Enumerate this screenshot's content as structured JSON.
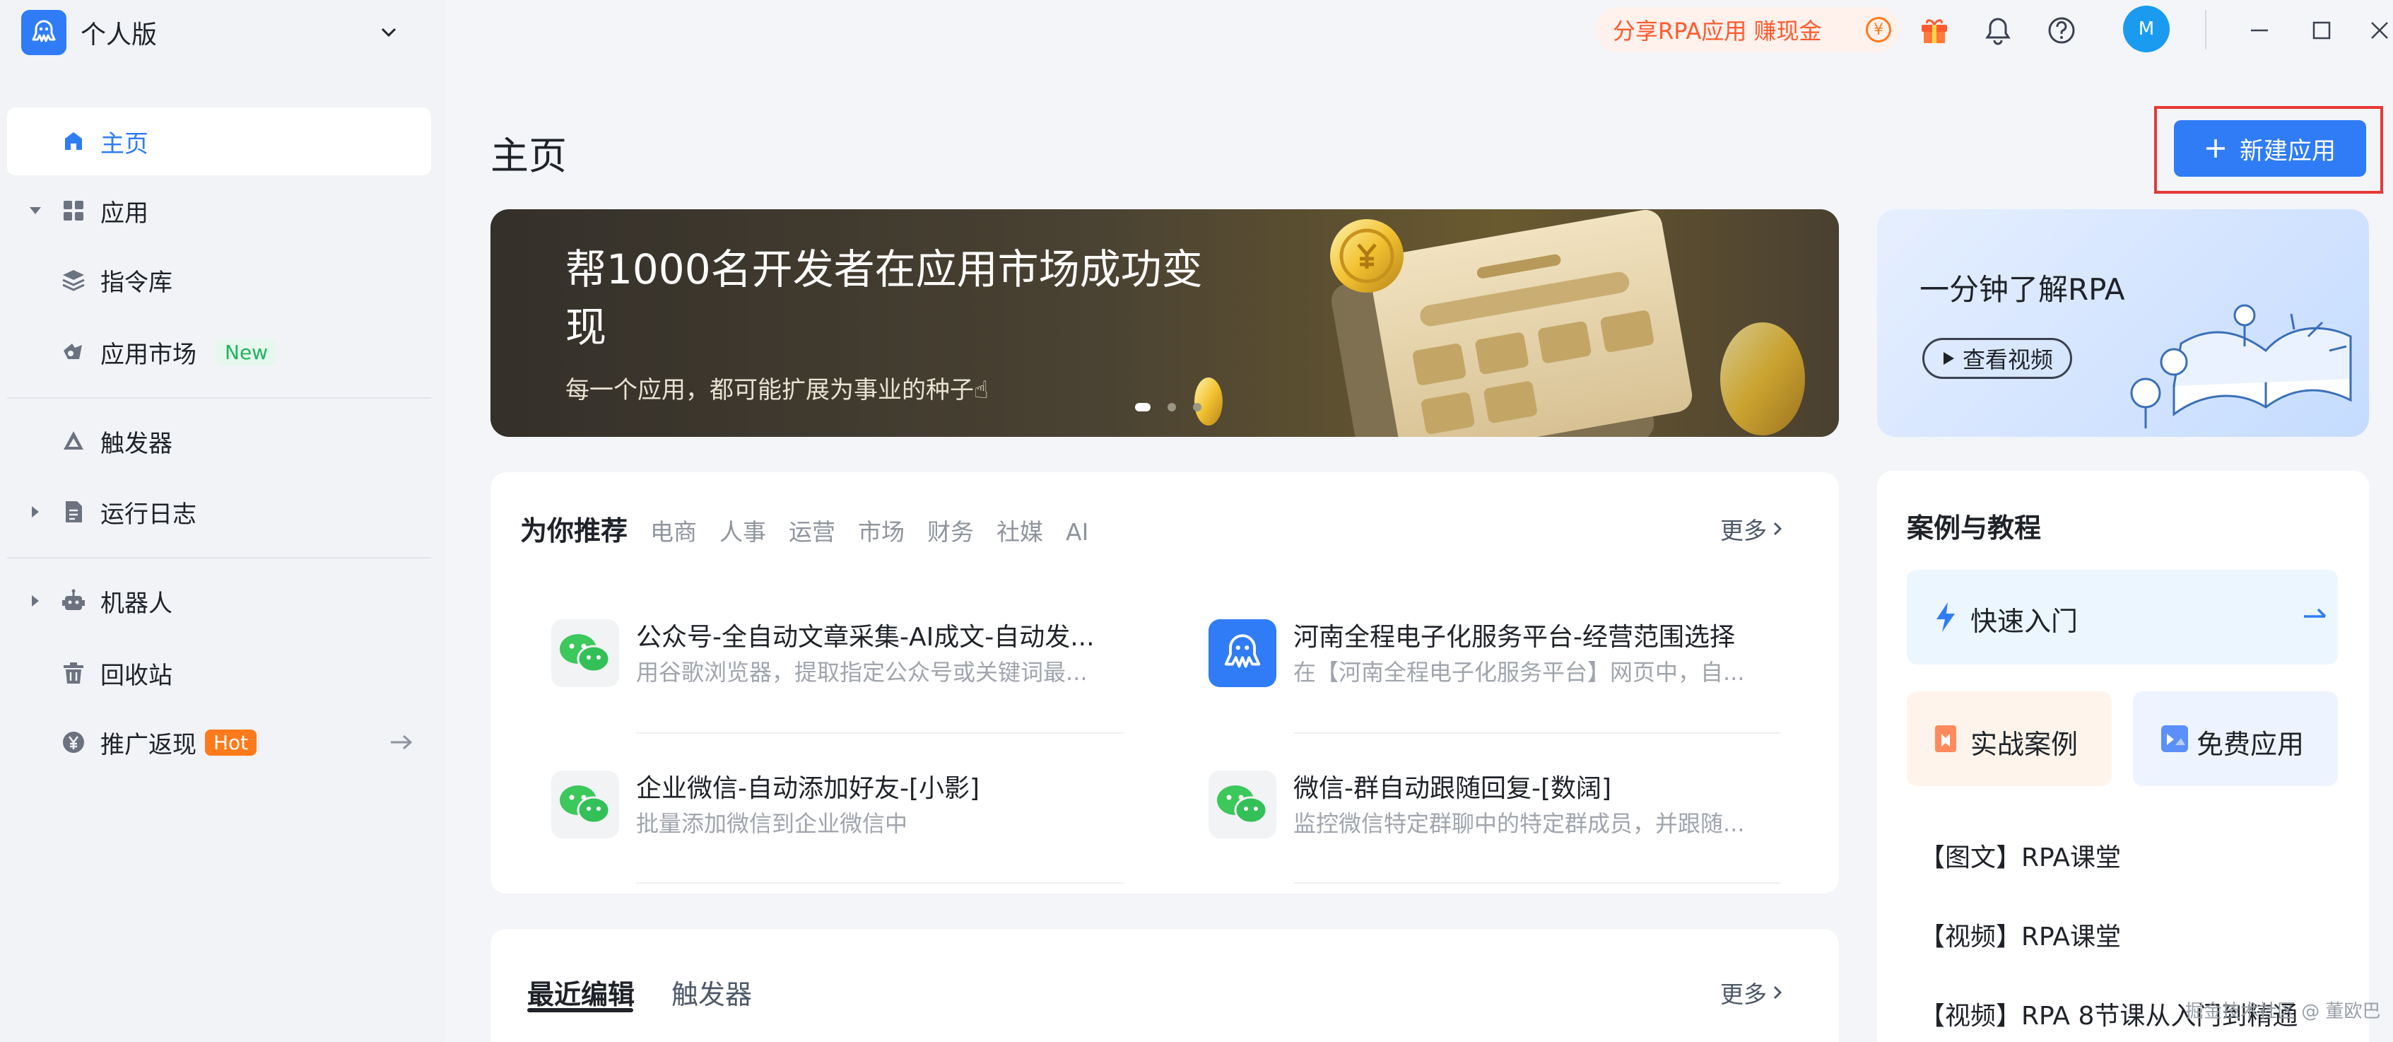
{
  "sidebar": {
    "workspace": "个人版",
    "items": [
      {
        "label": "主页"
      },
      {
        "label": "应用"
      },
      {
        "label": "指令库"
      },
      {
        "label": "应用市场",
        "badge": "New"
      },
      {
        "label": "触发器"
      },
      {
        "label": "运行日志"
      },
      {
        "label": "机器人"
      },
      {
        "label": "回收站"
      },
      {
        "label": "推广返现",
        "badge": "Hot"
      }
    ]
  },
  "topbar": {
    "share_text": "分享RPA应用 赚现金",
    "coin_symbol": "¥",
    "avatar_initial": "M"
  },
  "main": {
    "title": "主页",
    "new_app_button": "新建应用",
    "banner": {
      "title": "帮1000名开发者在应用市场成功变现",
      "subtitle": "每一个应用，都可能扩展为事业的种子☝"
    },
    "rpa_card": {
      "title": "一分钟了解RPA",
      "watch_button": "查看视频"
    },
    "recommend": {
      "title": "为你推荐",
      "tabs": [
        "电商",
        "人事",
        "运营",
        "市场",
        "财务",
        "社媒",
        "AI"
      ],
      "more": "更多",
      "items": [
        {
          "title": "公众号-全自动文章采集-AI成文-自动发...",
          "desc": "用谷歌浏览器，提取指定公众号或关键词最..."
        },
        {
          "title": "河南全程电子化服务平台-经营范围选择",
          "desc": "在【河南全程电子化服务平台】网页中，自..."
        },
        {
          "title": "企业微信-自动添加好友-[小影]",
          "desc": "批量添加微信到企业微信中"
        },
        {
          "title": "微信-群自动跟随回复-[数阔]",
          "desc": "监控微信特定群聊中的特定群成员，并跟随..."
        }
      ]
    },
    "recent": {
      "tabs": [
        "最近编辑",
        "触发器"
      ],
      "more": "更多"
    }
  },
  "cases": {
    "title": "案例与教程",
    "quick_start": "快速入门",
    "practice": "实战案例",
    "free_apps": "免费应用",
    "list": [
      "【图文】RPA课堂",
      "【视频】RPA课堂",
      "【视频】RPA 8节课从入门到精通"
    ]
  },
  "watermark": "掘金技术社区 @ 董欧巴"
}
